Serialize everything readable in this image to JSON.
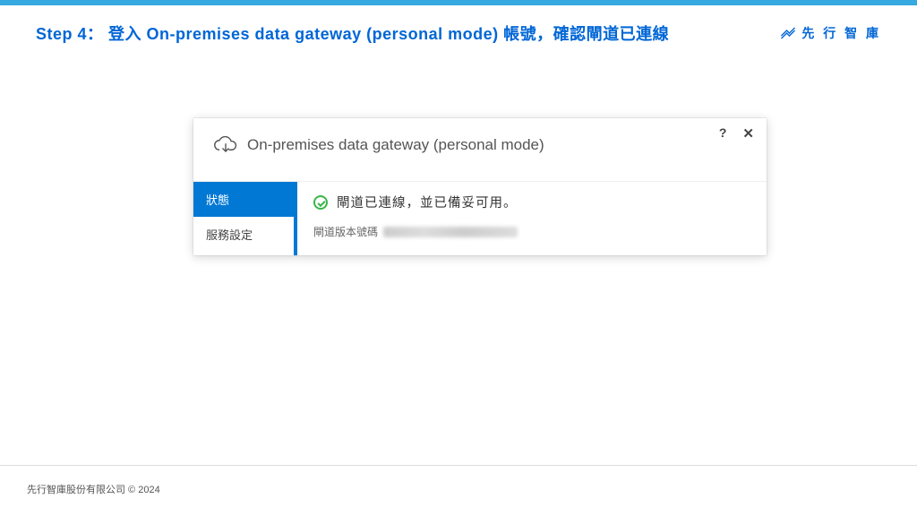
{
  "header": {
    "title": "Step 4： 登入 On-premises data gateway (personal mode) 帳號，確認閘道已連線",
    "brand": "先 行 智 庫"
  },
  "window": {
    "title": "On-premises data gateway (personal mode)",
    "help_label": "?",
    "close_label": "✕",
    "sidebar": {
      "items": [
        {
          "label": "狀態",
          "active": true
        },
        {
          "label": "服務設定",
          "active": false
        }
      ]
    },
    "content": {
      "status_text": "閘道已連線，並已備妥可用。",
      "version_label": "閘道版本號碼"
    }
  },
  "footer": {
    "copyright": "先行智庫股份有限公司  © 2024"
  }
}
